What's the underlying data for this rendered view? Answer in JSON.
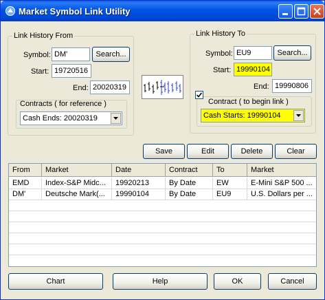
{
  "window": {
    "title": "Market Symbol Link Utility"
  },
  "from": {
    "group_label": "Link History From",
    "symbol_label": "Symbol:",
    "symbol_value": "DM'",
    "search_label": "Search...",
    "start_label": "Start:",
    "start_value": "19720516",
    "end_label": "End:",
    "end_value": "20020319",
    "contracts_label": "Contracts ( for reference )",
    "contracts_value": "Cash  Ends: 20020319"
  },
  "to": {
    "group_label": "Link History To",
    "symbol_label": "Symbol:",
    "symbol_value": "EU9",
    "search_label": "Search...",
    "start_label": "Start:",
    "start_value": "19990104",
    "end_label": "End:",
    "end_value": "19990806",
    "contract_label": "Contract ( to begin link  )",
    "contract_checked": true,
    "contract_value": "Cash  Starts: 19990104"
  },
  "actions": {
    "save": "Save",
    "edit": "Edit",
    "delete": "Delete",
    "clear": "Clear"
  },
  "table": {
    "headers": [
      "From",
      "Market",
      "Date",
      "Contract",
      "To",
      "Market"
    ],
    "rows": [
      [
        "EMD",
        "Index-S&P Midc...",
        "19920213",
        "By Date",
        "EW",
        "E-Mini S&P 500 ..."
      ],
      [
        "DM'",
        "Deutsche Mark(...",
        "19990104",
        "By Date",
        "EU9",
        "U.S. Dollars per ..."
      ]
    ]
  },
  "footer": {
    "chart": "Chart",
    "help": "Help",
    "ok": "OK",
    "cancel": "Cancel"
  },
  "colors": {
    "highlight": "#ffff00",
    "titlebar": "#0055e5"
  }
}
